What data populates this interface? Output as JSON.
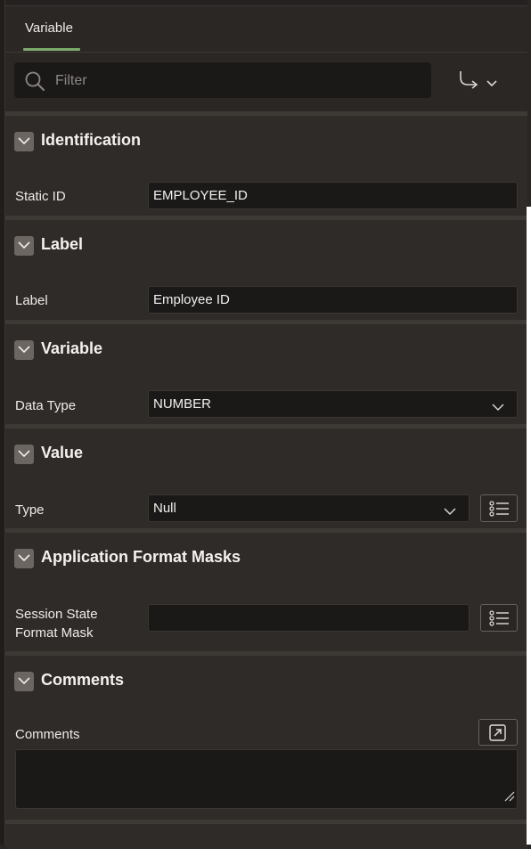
{
  "tabs": [
    {
      "label": "Variable",
      "active": true
    }
  ],
  "search": {
    "placeholder": "Filter",
    "value": ""
  },
  "toolbar": {
    "goto_icon": "goto-arrow-icon"
  },
  "sections": {
    "identification": {
      "title": "Identification",
      "static_id_label": "Static ID",
      "static_id_value": "EMPLOYEE_ID"
    },
    "label": {
      "title": "Label",
      "label_label": "Label",
      "label_value": "Employee ID"
    },
    "variable": {
      "title": "Variable",
      "data_type_label": "Data Type",
      "data_type_value": "NUMBER"
    },
    "value": {
      "title": "Value",
      "type_label": "Type",
      "type_value": "Null"
    },
    "format_masks": {
      "title": "Application Format Masks",
      "session_state_label_line1": "Session State",
      "session_state_label_line2": "Format Mask",
      "session_state_value": ""
    },
    "comments": {
      "title": "Comments",
      "comments_label": "Comments",
      "comments_value": ""
    }
  },
  "colors": {
    "accent": "#7dab6c",
    "panel_bg": "#2f2b28",
    "field_bg": "#1b1918"
  }
}
